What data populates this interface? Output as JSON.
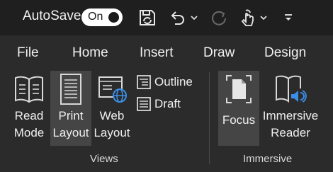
{
  "quick_access": {
    "autosave_label": "AutoSave",
    "autosave_state": "On",
    "icons": [
      "save-sync-icon",
      "undo-icon",
      "redo-icon",
      "touch-mode-icon",
      "customize-qat-icon"
    ]
  },
  "tabs": [
    "File",
    "Home",
    "Insert",
    "Draw",
    "Design"
  ],
  "ribbon": {
    "views_group": {
      "label": "Views",
      "read_mode": [
        "Read",
        "Mode"
      ],
      "print_layout": [
        "Print",
        "Layout"
      ],
      "web_layout": [
        "Web",
        "Layout"
      ],
      "outline": "Outline",
      "draft": "Draft"
    },
    "immersive_group": {
      "label": "Immersive",
      "focus": "Focus",
      "immersive_reader": [
        "Immersive",
        "Reader"
      ]
    }
  },
  "colors": {
    "background": "#2b2b2b",
    "title_bar": "#1f1f1f",
    "pressed": "#454545",
    "accent_blue": "#3a8ee6"
  }
}
